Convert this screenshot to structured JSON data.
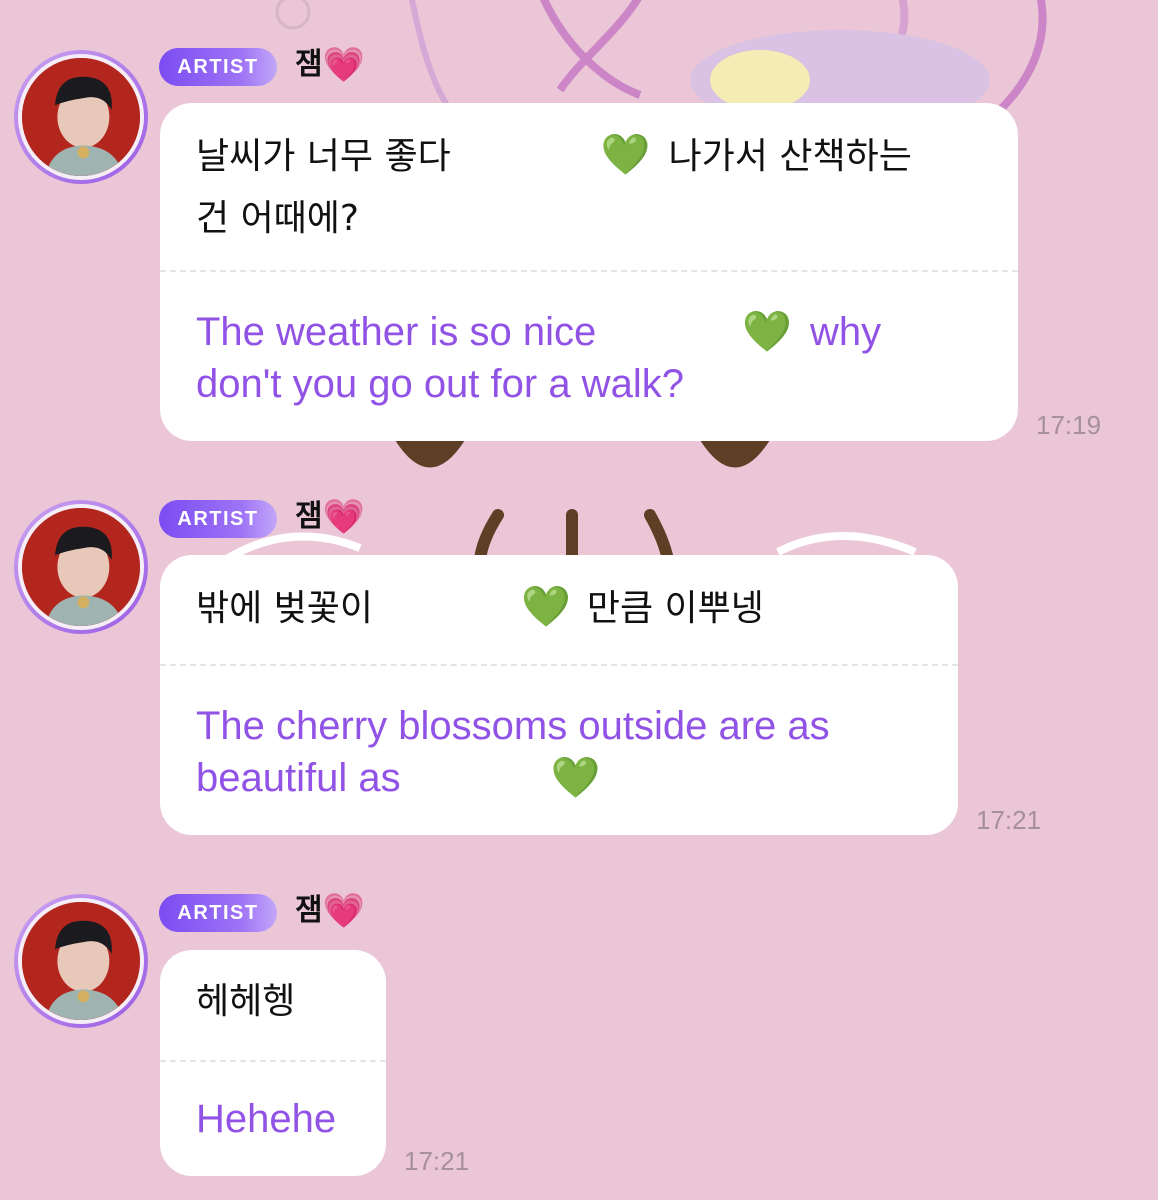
{
  "background_color": "#ebc6d6",
  "accent_color": "#9152e6",
  "badge_color": "#7b4cf2",
  "messages": [
    {
      "badge": "ARTIST",
      "sender": "잼",
      "sender_emoji": "💗",
      "korean_line1_a": "날씨가 너무 좋다",
      "korean_emoji": "💚",
      "korean_line1_b": "나가서 산책하는",
      "korean_line2": "건 어때에?",
      "english_line1_a": "The weather is so nice",
      "english_emoji": "💚",
      "english_line1_b": "why",
      "english_line2": "don't you go out for a walk?",
      "time": "17:19"
    },
    {
      "badge": "ARTIST",
      "sender": "잼",
      "sender_emoji": "💗",
      "korean_line1_a": "밖에 벚꽃이",
      "korean_emoji": "💚",
      "korean_line1_b": "만큼 이뿌넹",
      "english_line1": "The cherry blossoms outside are as",
      "english_line2_a": "beautiful as",
      "english_emoji": "💚",
      "time": "17:21"
    },
    {
      "badge": "ARTIST",
      "sender": "잼",
      "sender_emoji": "💗",
      "korean_line1": "헤헤헹",
      "english_line1": "Hehehe",
      "time": "17:21"
    }
  ]
}
